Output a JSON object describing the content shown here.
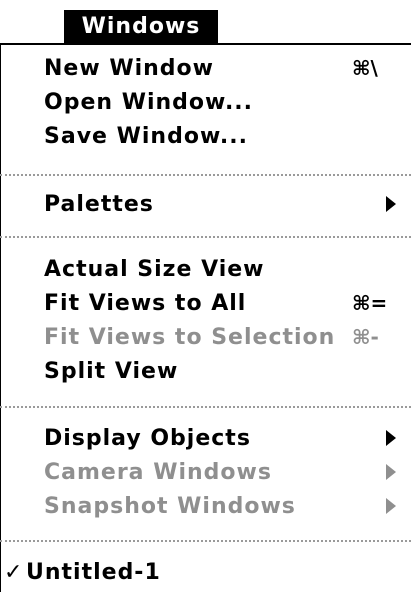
{
  "menu": {
    "title": "Windows",
    "items": [
      {
        "label": "New Window",
        "shortcut": "⌘\\",
        "enabled": true
      },
      {
        "label": "Open Window...",
        "shortcut": "",
        "enabled": true
      },
      {
        "label": "Save Window...",
        "shortcut": "",
        "enabled": true
      },
      {
        "label": "Palettes",
        "shortcut": "",
        "enabled": true,
        "submenu": true
      },
      {
        "label": "Actual Size View",
        "shortcut": "",
        "enabled": true
      },
      {
        "label": "Fit Views to All",
        "shortcut": "⌘=",
        "enabled": true
      },
      {
        "label": "Fit Views to Selection",
        "shortcut": "⌘-",
        "enabled": false
      },
      {
        "label": "Split View",
        "shortcut": "",
        "enabled": true
      },
      {
        "label": "Display Objects",
        "shortcut": "",
        "enabled": true,
        "submenu": true
      },
      {
        "label": "Camera Windows",
        "shortcut": "",
        "enabled": false,
        "submenu": true
      },
      {
        "label": "Snapshot Windows",
        "shortcut": "",
        "enabled": false,
        "submenu": true
      },
      {
        "label": "Untitled-1",
        "shortcut": "",
        "enabled": true,
        "checked": true,
        "check_mark": "✓"
      }
    ]
  },
  "colors": {
    "enabled_text": "#000000",
    "disabled_text": "#8f8f8f",
    "title_bg": "#000000",
    "title_text": "#ffffff"
  }
}
